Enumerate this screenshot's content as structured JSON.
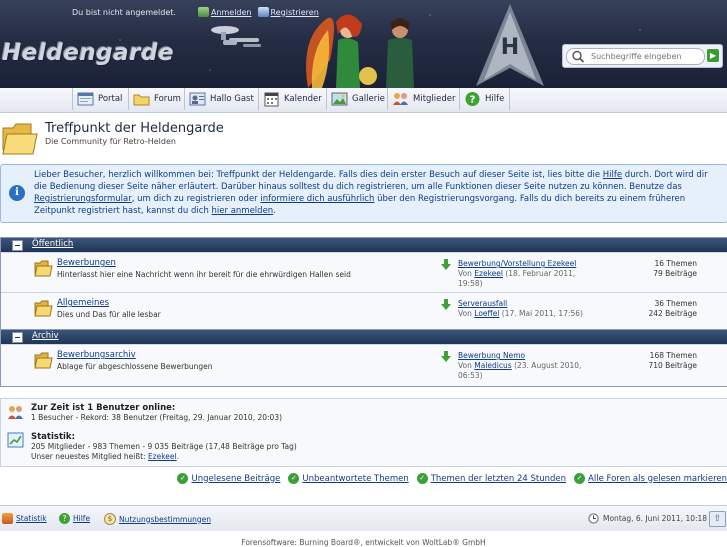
{
  "header": {
    "login_status": "Du bist nicht angemeldet.",
    "login_link": "Anmelden",
    "register_link": "Registrieren",
    "logo_text": "Heldengarde",
    "search_placeholder": "Suchbegriffe eingeben",
    "search_go_icon": "arrow-right-icon"
  },
  "nav": {
    "tabs": [
      {
        "label": "Portal",
        "icon": "portal-icon"
      },
      {
        "label": "Forum",
        "icon": "folder-icon"
      },
      {
        "label": "Hallo Gast",
        "icon": "user-card-icon"
      },
      {
        "label": "Kalender",
        "icon": "calendar-icon"
      },
      {
        "label": "Gallerie",
        "icon": "gallery-icon"
      },
      {
        "label": "Mitglieder",
        "icon": "members-icon"
      },
      {
        "label": "Hilfe",
        "icon": "help-icon"
      }
    ]
  },
  "page": {
    "title": "Treffpunkt der Heldengarde",
    "subtitle": "Die Community für Retro-Helden"
  },
  "info": {
    "part1": "Lieber Besucher, herzlich willkommen bei: Treffpunkt der Heldengarde. Falls dies dein erster Besuch auf dieser Seite ist, lies bitte die ",
    "link_help": "Hilfe",
    "part2": " durch. Dort wird dir die Bedienung dieser Seite näher erläutert. Darüber hinaus solltest du dich registrieren, um alle Funktionen dieser Seite nutzen zu können. Benutze das ",
    "link_register_form": "Registrierungsformular",
    "part3": ", um dich zu registrieren oder ",
    "link_info": "informiere dich ausführlich",
    "part4": " über den Registrierungsvorgang. Falls du dich bereits zu einem früheren Zeitpunkt registriert hast, kannst du dich ",
    "link_login": "hier anmelden",
    "part5": "."
  },
  "categories": [
    {
      "title": "Öffentlich",
      "boards": [
        {
          "name": "Bewerbungen",
          "desc": "Hinterlasst hier eine Nachricht wenn ihr bereit für die ehrwürdigen Hallen seid",
          "last_title": "Bewerbung/Vorstellung Ezekeel",
          "by": "Von ",
          "last_user": "Ezekeel",
          "last_date": " (18. Februar 2011, 19:58)",
          "threads": "16 Themen",
          "posts": "79 Beiträge"
        },
        {
          "name": "Allgemeines",
          "desc": "Dies und Das für alle lesbar",
          "last_title": "Serverausfall",
          "by": "Von ",
          "last_user": "Loeffel",
          "last_date": " (17. Mai 2011, 17:56)",
          "threads": "36 Themen",
          "posts": "242 Beiträge"
        }
      ]
    },
    {
      "title": "Archiv",
      "boards": [
        {
          "name": "Bewerbungsarchiv",
          "desc": "Ablage für abgeschlossene Bewerbungen",
          "last_title": "Bewerbung Nemo",
          "by": "Von ",
          "last_user": "Maledicus",
          "last_date": " (23. August 2010, 06:53)",
          "threads": "168 Themen",
          "posts": "710 Beiträge"
        }
      ]
    }
  ],
  "stats": {
    "online_head": "Zur Zeit ist 1 Benutzer online:",
    "online_detail": "1 Besucher - Rekord: 38 Benutzer (Freitag, 29. Januar 2010, 20:03)",
    "stats_head": "Statistik:",
    "stats_detail": "205 Mitglieder - 983 Themen - 9 035 Beiträge (17,48 Beiträge pro Tag)",
    "newest_prefix": "Unser neuestes Mitglied heißt: ",
    "newest_user": "Ezekeel",
    "newest_suffix": "."
  },
  "quick_links": [
    "Ungelesene Beiträge",
    "Unbeantwortete Themen",
    "Themen der letzten 24 Stunden",
    "Alle Foren als gelesen markieren"
  ],
  "footer": {
    "statistik": "Statistik",
    "hilfe": "Hilfe",
    "nutzung": "Nutzungsbestimmungen",
    "datetime": "Montag, 6. Juni 2011, 10:18",
    "copyright": "Forensoftware: Burning Board®, entwickelt von WoltLab® GmbH"
  }
}
